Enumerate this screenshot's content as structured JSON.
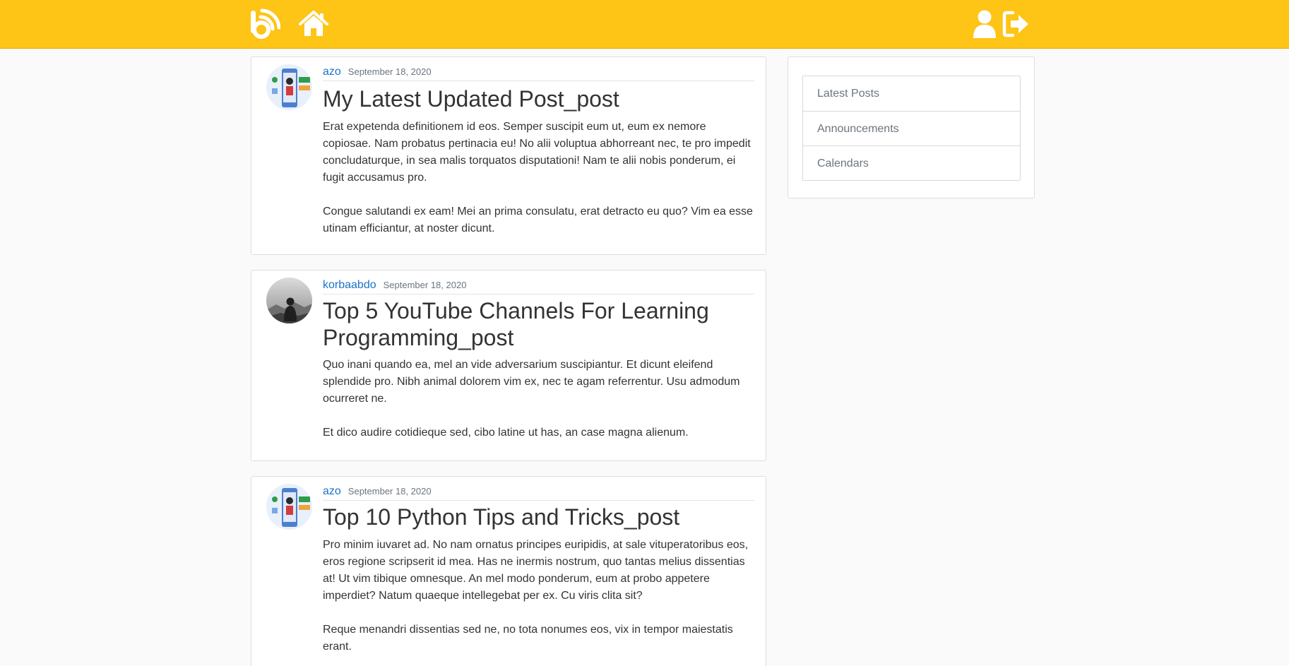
{
  "nav": {
    "brand_icon": "blog-logo-icon",
    "home_icon": "home-icon",
    "profile_icon": "user-icon",
    "logout_icon": "sign-out-icon",
    "colors": {
      "bar": "#fec416",
      "icons": "#ffffff"
    }
  },
  "posts": [
    {
      "author": "azo",
      "date": "September 18, 2020",
      "title": "My Latest Updated Post_post",
      "paragraphs": [
        "Erat expetenda definitionem id eos. Semper suscipit eum ut, eum ex nemore copiosae. Nam probatus pertinacia eu! No alii voluptua abhorreant nec, te pro impedit concludaturque, in sea malis torquatos disputationi! Nam te alii nobis ponderum, ei fugit accusamus pro.",
        "Congue salutandi ex eam! Mei an prima consulatu, erat detracto eu quo? Vim ea esse utinam efficiantur, at noster dicunt."
      ]
    },
    {
      "author": "korbaabdo",
      "date": "September 18, 2020",
      "title": "Top 5 YouTube Channels For Learning Programming_post",
      "paragraphs": [
        "Quo inani quando ea, mel an vide adversarium suscipiantur. Et dicunt eleifend splendide pro. Nibh animal dolorem vim ex, nec te agam referrentur. Usu admodum ocurreret ne.",
        "Et dico audire cotidieque sed, cibo latine ut has, an case magna alienum."
      ]
    },
    {
      "author": "azo",
      "date": "September 18, 2020",
      "title": "Top 10 Python Tips and Tricks_post",
      "paragraphs": [
        "Pro minim iuvaret ad. No nam ornatus principes euripidis, at sale vituperatoribus eos, eros regione scripserit id mea. Has ne inermis nostrum, quo tantas melius dissentias at! Ut vim tibique omnesque. An mel modo ponderum, eum at probo appetere imperdiet? Natum quaeque intellegebat per ex. Cu viris clita sit?",
        "Reque menandri dissentias sed ne, no tota nonumes eos, vix in tempor maiestatis erant."
      ]
    }
  ],
  "sidebar": {
    "items": [
      "Latest Posts",
      "Announcements",
      "Calendars"
    ]
  },
  "colors": {
    "accent": "#fec416",
    "link": "#1a73c9",
    "muted": "#6c757d",
    "background": "#fafafa"
  }
}
